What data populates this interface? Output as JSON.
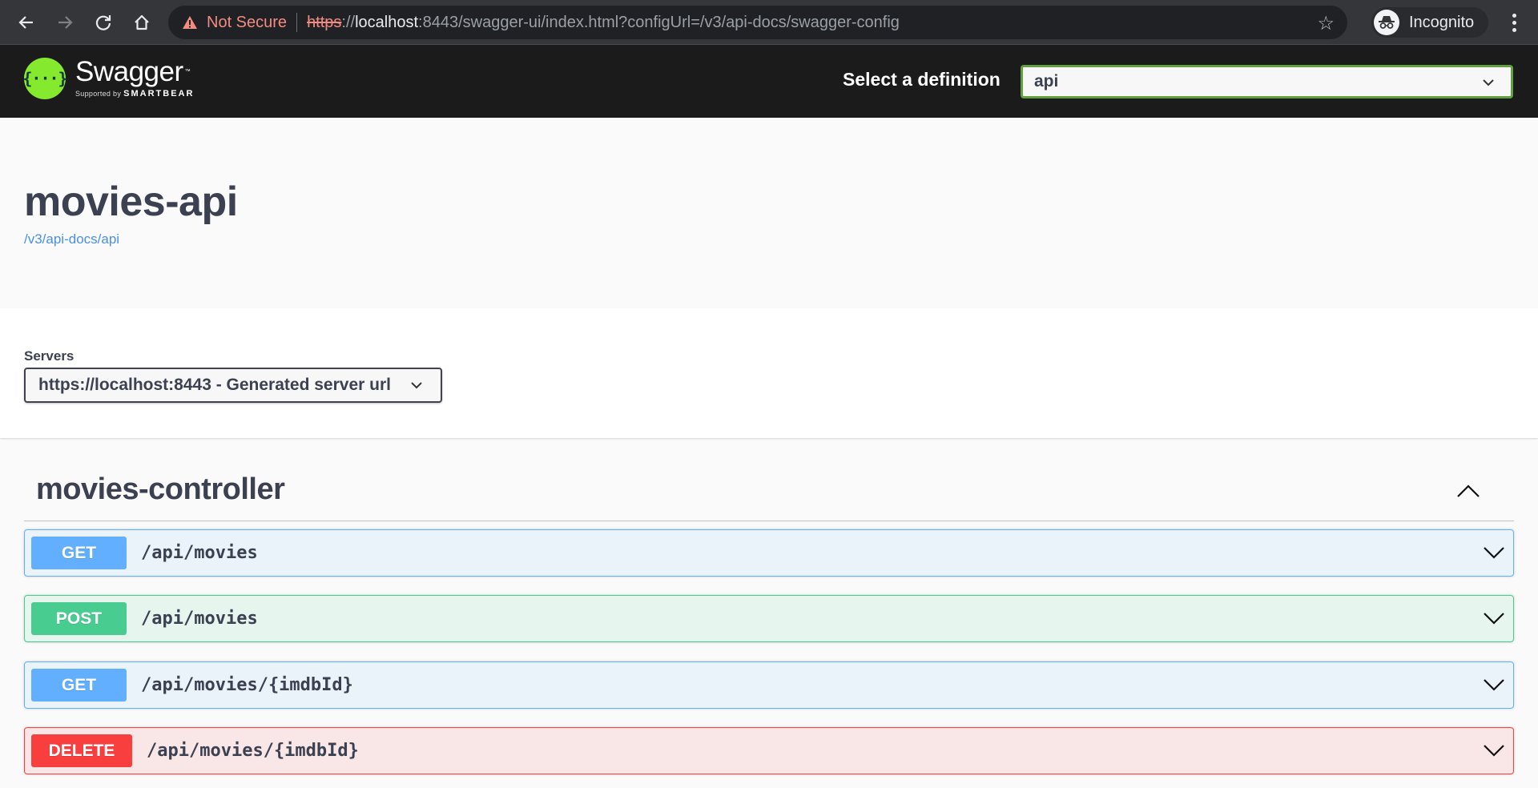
{
  "browser": {
    "security_label": "Not Secure",
    "url_scheme": "https",
    "url_separator": "://",
    "url_host": "localhost",
    "url_rest": ":8443/swagger-ui/index.html?configUrl=/v3/api-docs/swagger-config",
    "profile_label": "Incognito",
    "icons": [
      "back-icon",
      "forward-icon",
      "reload-icon",
      "home-icon",
      "warning-icon",
      "star-icon",
      "incognito-icon",
      "kebab-menu-icon"
    ]
  },
  "topbar": {
    "logo_name": "Swagger",
    "logo_tm": "™",
    "logo_supported_by": "Supported by",
    "logo_brand": "SMARTBEAR",
    "logo_glyph": "{···}",
    "definition_label": "Select a definition",
    "definition_selected": "api",
    "accent_color": "#62a03f"
  },
  "info": {
    "title": "movies-api",
    "spec_url": "/v3/api-docs/api"
  },
  "servers": {
    "label": "Servers",
    "selected": "https://localhost:8443 - Generated server url"
  },
  "tag": {
    "name": "movies-controller",
    "expanded": true
  },
  "operations": [
    {
      "method": "GET",
      "path": "/api/movies",
      "color": "#61affe"
    },
    {
      "method": "POST",
      "path": "/api/movies",
      "color": "#49cc90"
    },
    {
      "method": "GET",
      "path": "/api/movies/{imdbId}",
      "color": "#61affe"
    },
    {
      "method": "DELETE",
      "path": "/api/movies/{imdbId}",
      "color": "#f93e3e"
    }
  ]
}
